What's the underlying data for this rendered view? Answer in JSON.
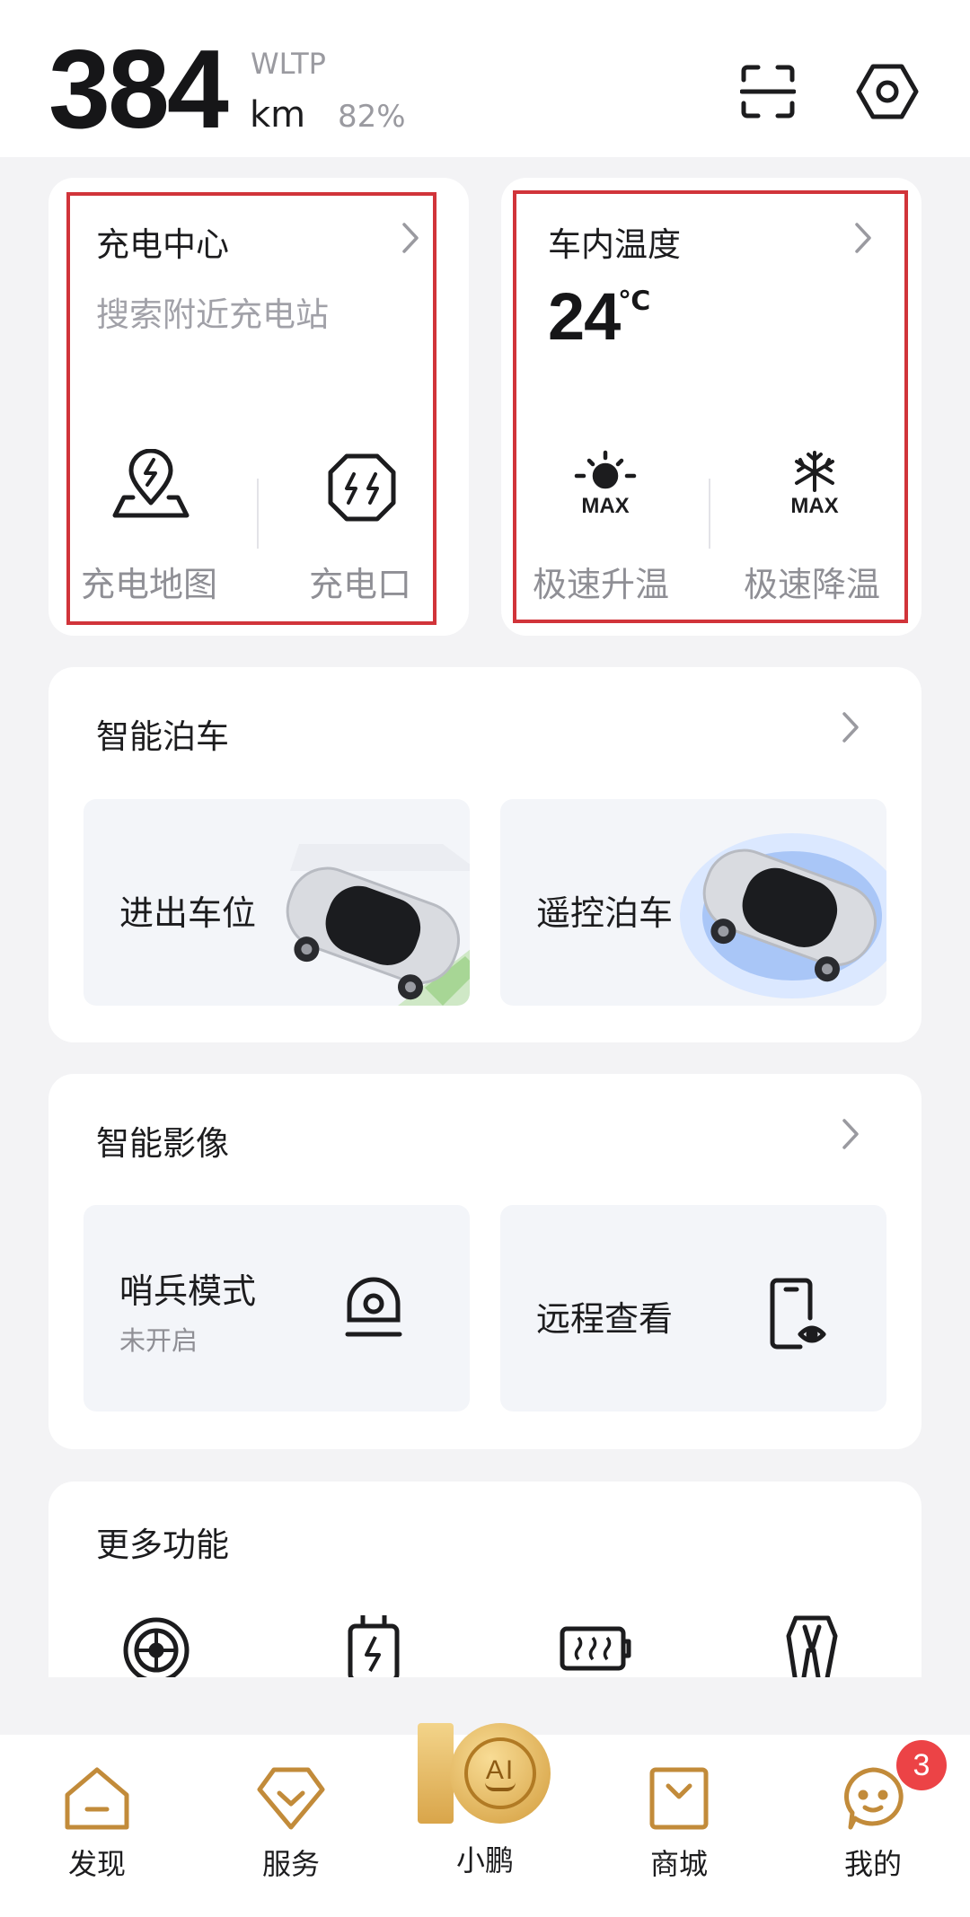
{
  "header": {
    "range_value": "384",
    "range_standard": "WLTP",
    "range_unit": "km",
    "battery_percent": "82%"
  },
  "charging_card": {
    "title": "充电中心",
    "subtitle": "搜索附近充电站",
    "actions": [
      {
        "label": "充电地图",
        "icon": "charging-map-pin-icon"
      },
      {
        "label": "充电口",
        "icon": "charge-port-icon"
      }
    ]
  },
  "temperature_card": {
    "title": "车内温度",
    "value": "24",
    "unit": "℃",
    "actions": [
      {
        "label": "极速升温",
        "icon": "max-heat-icon",
        "icon_text": "MAX"
      },
      {
        "label": "极速降温",
        "icon": "max-cool-icon",
        "icon_text": "MAX"
      }
    ]
  },
  "parking_card": {
    "title": "智能泊车",
    "tiles": [
      {
        "label": "进出车位",
        "image": "car-parking-image"
      },
      {
        "label": "遥控泊车",
        "image": "car-remote-image"
      }
    ]
  },
  "video_card": {
    "title": "智能影像",
    "tiles": [
      {
        "label": "哨兵模式",
        "sub": "未开启",
        "icon": "sentry-camera-icon"
      },
      {
        "label": "远程查看",
        "sub": "",
        "icon": "remote-view-phone-icon"
      }
    ]
  },
  "more_card": {
    "title": "更多功能",
    "icons": [
      "tire-icon",
      "charger-plug-icon",
      "battery-heat-icon",
      "seat-icon"
    ]
  },
  "bottom_nav": {
    "items": [
      {
        "label": "发现",
        "icon": "home-icon"
      },
      {
        "label": "服务",
        "icon": "service-icon"
      },
      {
        "label": "小鹏",
        "icon": "xiaopeng-ai-icon",
        "icon_text": "AI"
      },
      {
        "label": "商城",
        "icon": "shop-bag-icon"
      },
      {
        "label": "我的",
        "icon": "profile-icon"
      }
    ],
    "profile_badge": "3"
  },
  "colors": {
    "highlight_border": "#d1343a",
    "badge": "#ec4346",
    "accent_gold": "#d9a54a"
  }
}
